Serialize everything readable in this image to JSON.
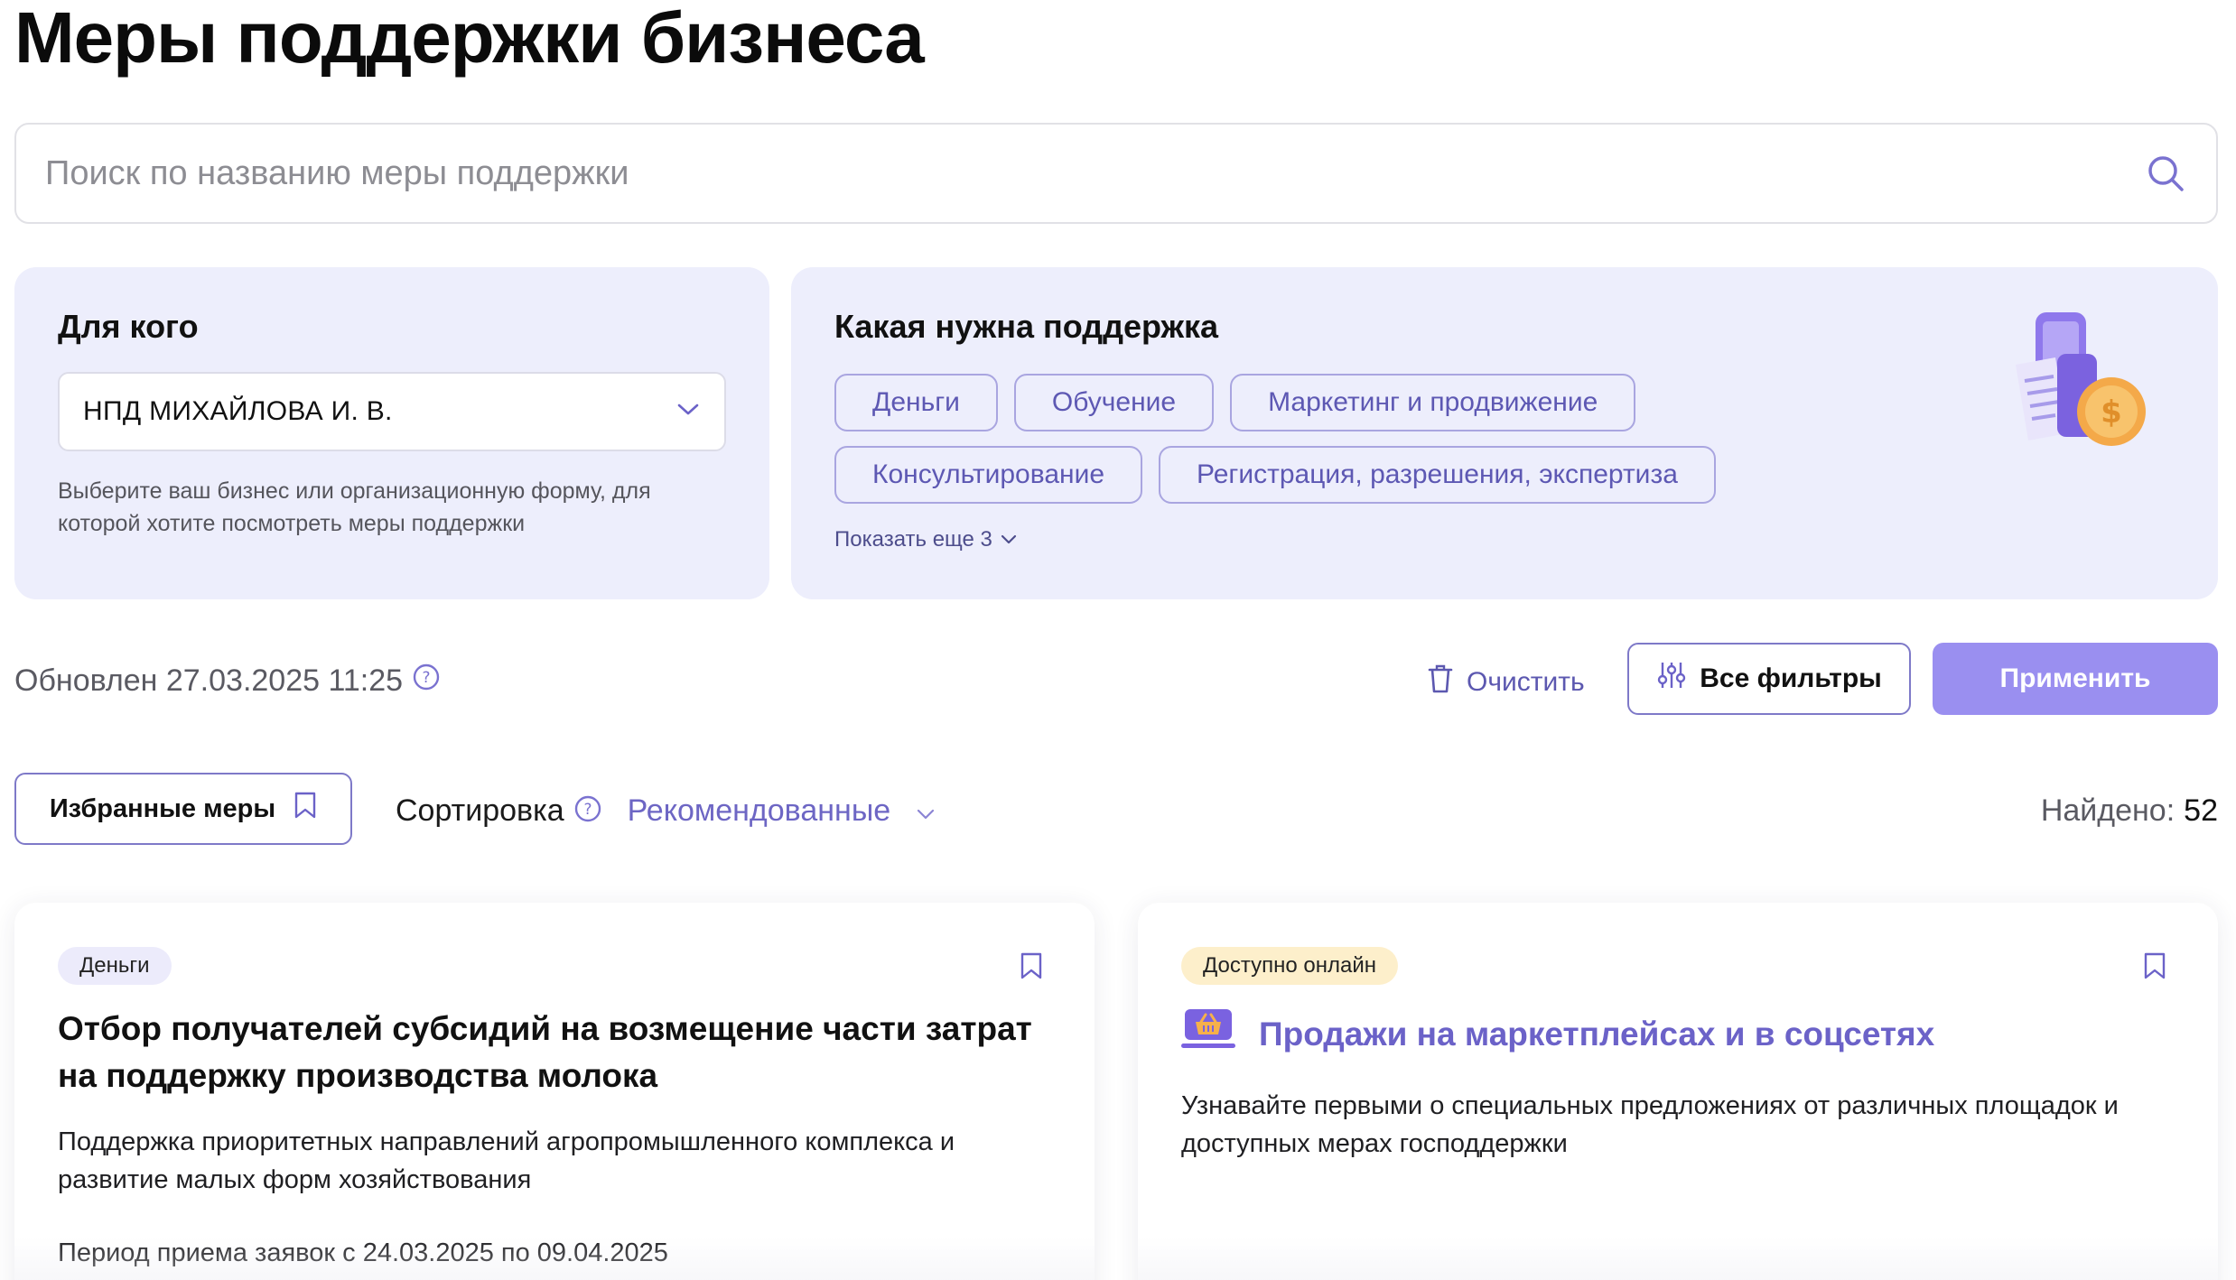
{
  "page": {
    "title": "Меры поддержки бизнеса"
  },
  "search": {
    "placeholder": "Поиск по названию меры поддержки"
  },
  "who_panel": {
    "heading": "Для кого",
    "selected": "НПД МИХАЙЛОВА И. В.",
    "hint": "Выберите ваш бизнес или организационную форму, для которой хотите посмотреть меры поддержки"
  },
  "support_panel": {
    "heading": "Какая нужна поддержка",
    "chips": [
      "Деньги",
      "Обучение",
      "Маркетинг и продвижение",
      "Консультирование",
      "Регистрация, разрешения, экспертиза"
    ],
    "show_more": "Показать еще 3"
  },
  "toolbar": {
    "updated": "Обновлен 27.03.2025 11:25",
    "clear": "Очистить",
    "all_filters": "Все фильтры",
    "apply": "Применить"
  },
  "list_controls": {
    "favorites": "Избранные меры",
    "sort_label": "Сортировка",
    "sort_value": "Рекомендованные",
    "found_label": "Найдено:",
    "found_count": "52"
  },
  "cards": [
    {
      "tag": "Деньги",
      "title": "Отбор получателей субсидий на возмещение части затрат на поддержку производства молока",
      "description": "Поддержка приоритетных направлений агропромышленного комплекса и развитие малых форм хозяйствования",
      "period": "Период приема заявок с 24.03.2025 по 09.04.2025"
    },
    {
      "tag": "Доступно онлайн",
      "title": "Продажи на маркетплейсах и в соцсетях",
      "description": "Узнавайте первыми о специальных предложениях от различных площадок и доступных мерах господдержки",
      "icon": "marketplace-basket-icon"
    }
  ],
  "colors": {
    "accent": "#6b62c8",
    "panel_bg": "#edeefc",
    "apply_bg": "#9a8ff0",
    "tag_online_bg": "#fdefcb"
  }
}
